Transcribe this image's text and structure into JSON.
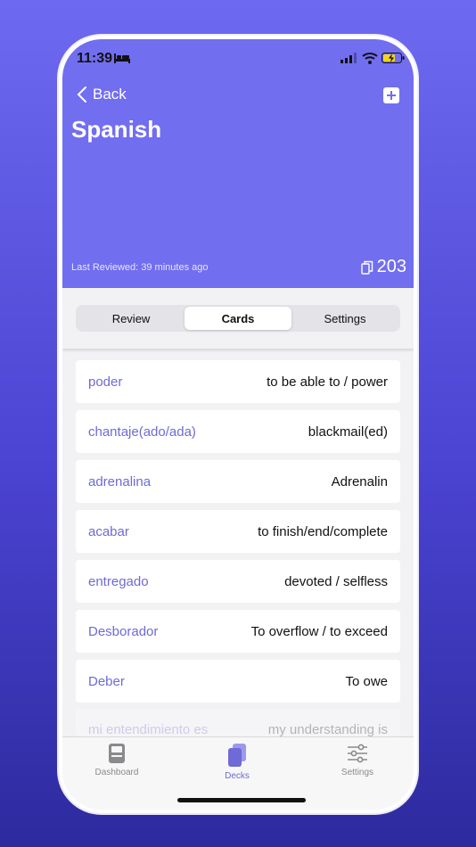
{
  "status": {
    "time": "11:39"
  },
  "header": {
    "back_label": "Back",
    "title": "Spanish",
    "last_reviewed": "Last Reviewed: 39 minutes ago",
    "card_count": "203",
    "accent_color": "#726ef0"
  },
  "segments": [
    {
      "label": "Review",
      "active": false
    },
    {
      "label": "Cards",
      "active": true
    },
    {
      "label": "Settings",
      "active": false
    }
  ],
  "cards": [
    {
      "term": "poder",
      "definition": "to be able to / power"
    },
    {
      "term": "chantaje(ado/ada)",
      "definition": "blackmail(ed)"
    },
    {
      "term": "adrenalina",
      "definition": "Adrenalin"
    },
    {
      "term": "acabar",
      "definition": "to finish/end/complete"
    },
    {
      "term": "entregado",
      "definition": "devoted / selfless"
    },
    {
      "term": "Desborador",
      "definition": "To overflow / to exceed"
    },
    {
      "term": "Deber",
      "definition": "To owe"
    },
    {
      "term": "mi entendimiento es",
      "definition": "my understanding is"
    }
  ],
  "tabs": [
    {
      "label": "Dashboard",
      "icon": "dashboard-icon",
      "active": false
    },
    {
      "label": "Decks",
      "icon": "decks-icon",
      "active": true
    },
    {
      "label": "Settings",
      "icon": "sliders-icon",
      "active": false
    }
  ]
}
